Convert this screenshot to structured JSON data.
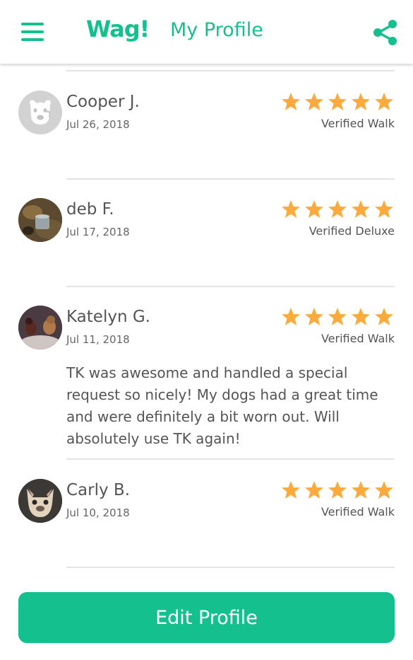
{
  "header": {
    "logo": "Wag!",
    "title": "My Profile",
    "menu_icon": "hamburger-menu-icon",
    "share_icon": "share-icon"
  },
  "colors": {
    "brand": "#15c08f",
    "star": "#fbaa3e",
    "divider": "#e4e4e4",
    "text": "#555555"
  },
  "reviews": [
    {
      "name": "Cooper J.",
      "date": "Jul 26, 2018",
      "rating": 5,
      "verified": "Verified Walk",
      "comment": ""
    },
    {
      "name": "deb F.",
      "date": "Jul 17, 2018",
      "rating": 5,
      "verified": "Verified Deluxe",
      "comment": ""
    },
    {
      "name": "Katelyn G.",
      "date": "Jul 11, 2018",
      "rating": 5,
      "verified": "Verified Walk",
      "comment": "TK was awesome and handled a special request so nicely! My dogs had a great time and were definitely a bit worn out. Will absolutely use TK again!"
    },
    {
      "name": "Carly B.",
      "date": "Jul 10, 2018",
      "rating": 5,
      "verified": "Verified Walk",
      "comment": ""
    }
  ],
  "edit_profile_label": "Edit Profile"
}
